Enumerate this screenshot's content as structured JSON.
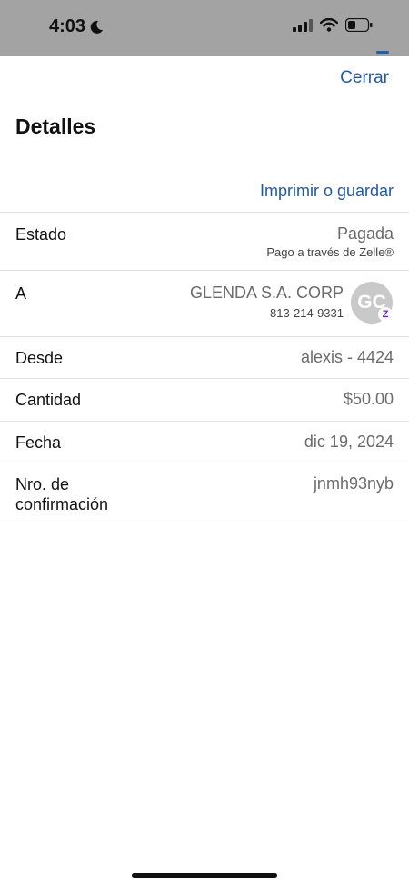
{
  "status_bar": {
    "time": "4:03",
    "icons": [
      "moon-icon",
      "cellular-signal-icon",
      "wifi-icon",
      "battery-icon"
    ]
  },
  "header": {
    "close_label": "Cerrar",
    "title": "Detalles",
    "print_label": "Imprimir o guardar"
  },
  "details": {
    "status": {
      "label": "Estado",
      "value": "Pagada",
      "sub": "Pago a través de Zelle®"
    },
    "recipient": {
      "label": "A",
      "name": "GLENDA S.A. CORP",
      "phone": "813-214-9331",
      "initials": "GC",
      "badge": "Z"
    },
    "from": {
      "label": "Desde",
      "value": "alexis - 4424"
    },
    "amount": {
      "label": "Cantidad",
      "value": "$50.00"
    },
    "date": {
      "label": "Fecha",
      "value": "dic 19, 2024"
    },
    "confirmation": {
      "label_line1": "Nro. de",
      "label_line2": "confirmación",
      "value": "jnmh93nyb"
    }
  },
  "colors": {
    "link": "#1f5aa6",
    "status_bar_bg": "#a3a3a3",
    "zelle_purple": "#6d1ed4"
  }
}
